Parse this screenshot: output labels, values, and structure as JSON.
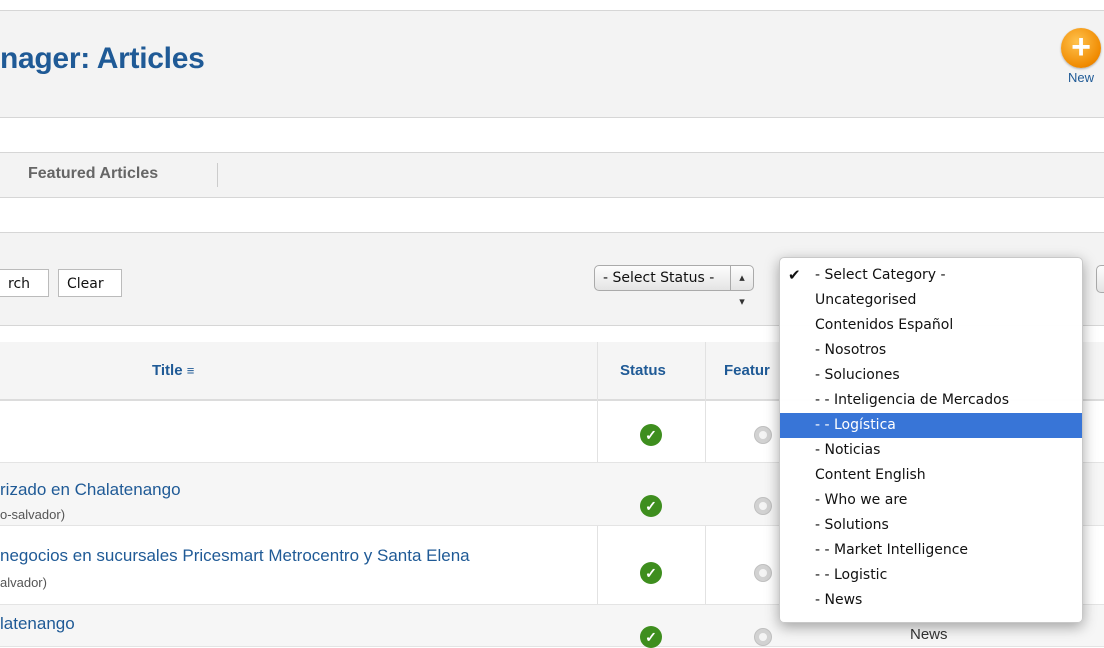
{
  "header": {
    "title": "nager: Articles",
    "new_label": "New",
    "new_icon": "plus-icon"
  },
  "submenu": {
    "item": "Featured Articles"
  },
  "filters": {
    "search_label": "rch",
    "clear_label": "Clear",
    "status_select": "- Select Status -"
  },
  "table": {
    "headers": {
      "title": "Title",
      "status": "Status",
      "featured": "Featur"
    },
    "rows": [
      {
        "title": "",
        "alias": ""
      },
      {
        "title": "rizado en Chalatenango",
        "alias": "o-salvador)"
      },
      {
        "title": "negocios en sucursales Pricesmart Metrocentro y Santa Elena",
        "alias": "alvador)"
      },
      {
        "title": "latenango",
        "alias": "",
        "category": "News"
      }
    ]
  },
  "category_dropdown": {
    "items": [
      {
        "label": "- Select Category -",
        "checked": true
      },
      {
        "label": "Uncategorised"
      },
      {
        "label": "Contenidos Español"
      },
      {
        "label": "- Nosotros"
      },
      {
        "label": "- Soluciones"
      },
      {
        "label": "- - Inteligencia de Mercados"
      },
      {
        "label": "- - Logística",
        "highlighted": true
      },
      {
        "label": "- Noticias"
      },
      {
        "label": "Content English"
      },
      {
        "label": "- Who we are"
      },
      {
        "label": "- Solutions"
      },
      {
        "label": "- - Market Intelligence"
      },
      {
        "label": "- - Logistic"
      },
      {
        "label": "- News"
      }
    ]
  },
  "colors": {
    "link": "#1f5a96",
    "accent": "#f08a00",
    "selection": "#3875d7",
    "published": "#3e8e1e"
  }
}
